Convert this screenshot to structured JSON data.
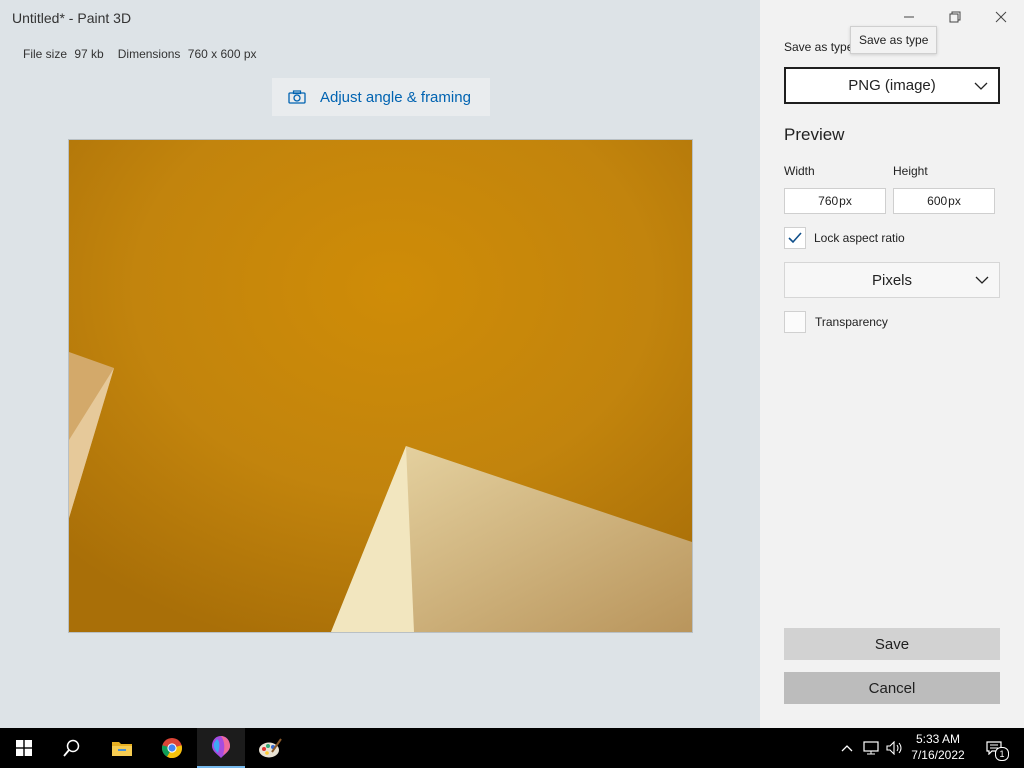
{
  "window": {
    "title": "Untitled* - Paint 3D"
  },
  "file_info": {
    "size_label": "File size",
    "size_value": "97 kb",
    "dimensions_label": "Dimensions",
    "dimensions_value": "760 x 600 px"
  },
  "adjust_button": {
    "label": "Adjust angle & framing",
    "icon": "camera-icon"
  },
  "save_panel": {
    "save_as_type_label": "Save as type",
    "tooltip": "Save as type",
    "type_value": "PNG (image)",
    "preview_title": "Preview",
    "width_label": "Width",
    "height_label": "Height",
    "width_value": "760",
    "height_value": "600",
    "unit_suffix": "px",
    "lock_aspect_label": "Lock aspect ratio",
    "lock_aspect_checked": true,
    "units_value": "Pixels",
    "transparency_label": "Transparency",
    "transparency_checked": false,
    "save_label": "Save",
    "cancel_label": "Cancel"
  },
  "taskbar": {
    "apps": [
      "start-icon",
      "search-icon",
      "file-explorer-icon",
      "chrome-icon",
      "paint3d-icon",
      "paint-icon"
    ],
    "active_app": "paint3d-icon",
    "time": "5:33 AM",
    "date": "7/16/2022",
    "notification_count": "1"
  },
  "colors": {
    "accent": "#0063b1",
    "canvas_bg": "#c88a0c",
    "shape_light": "#f0e2b4"
  }
}
